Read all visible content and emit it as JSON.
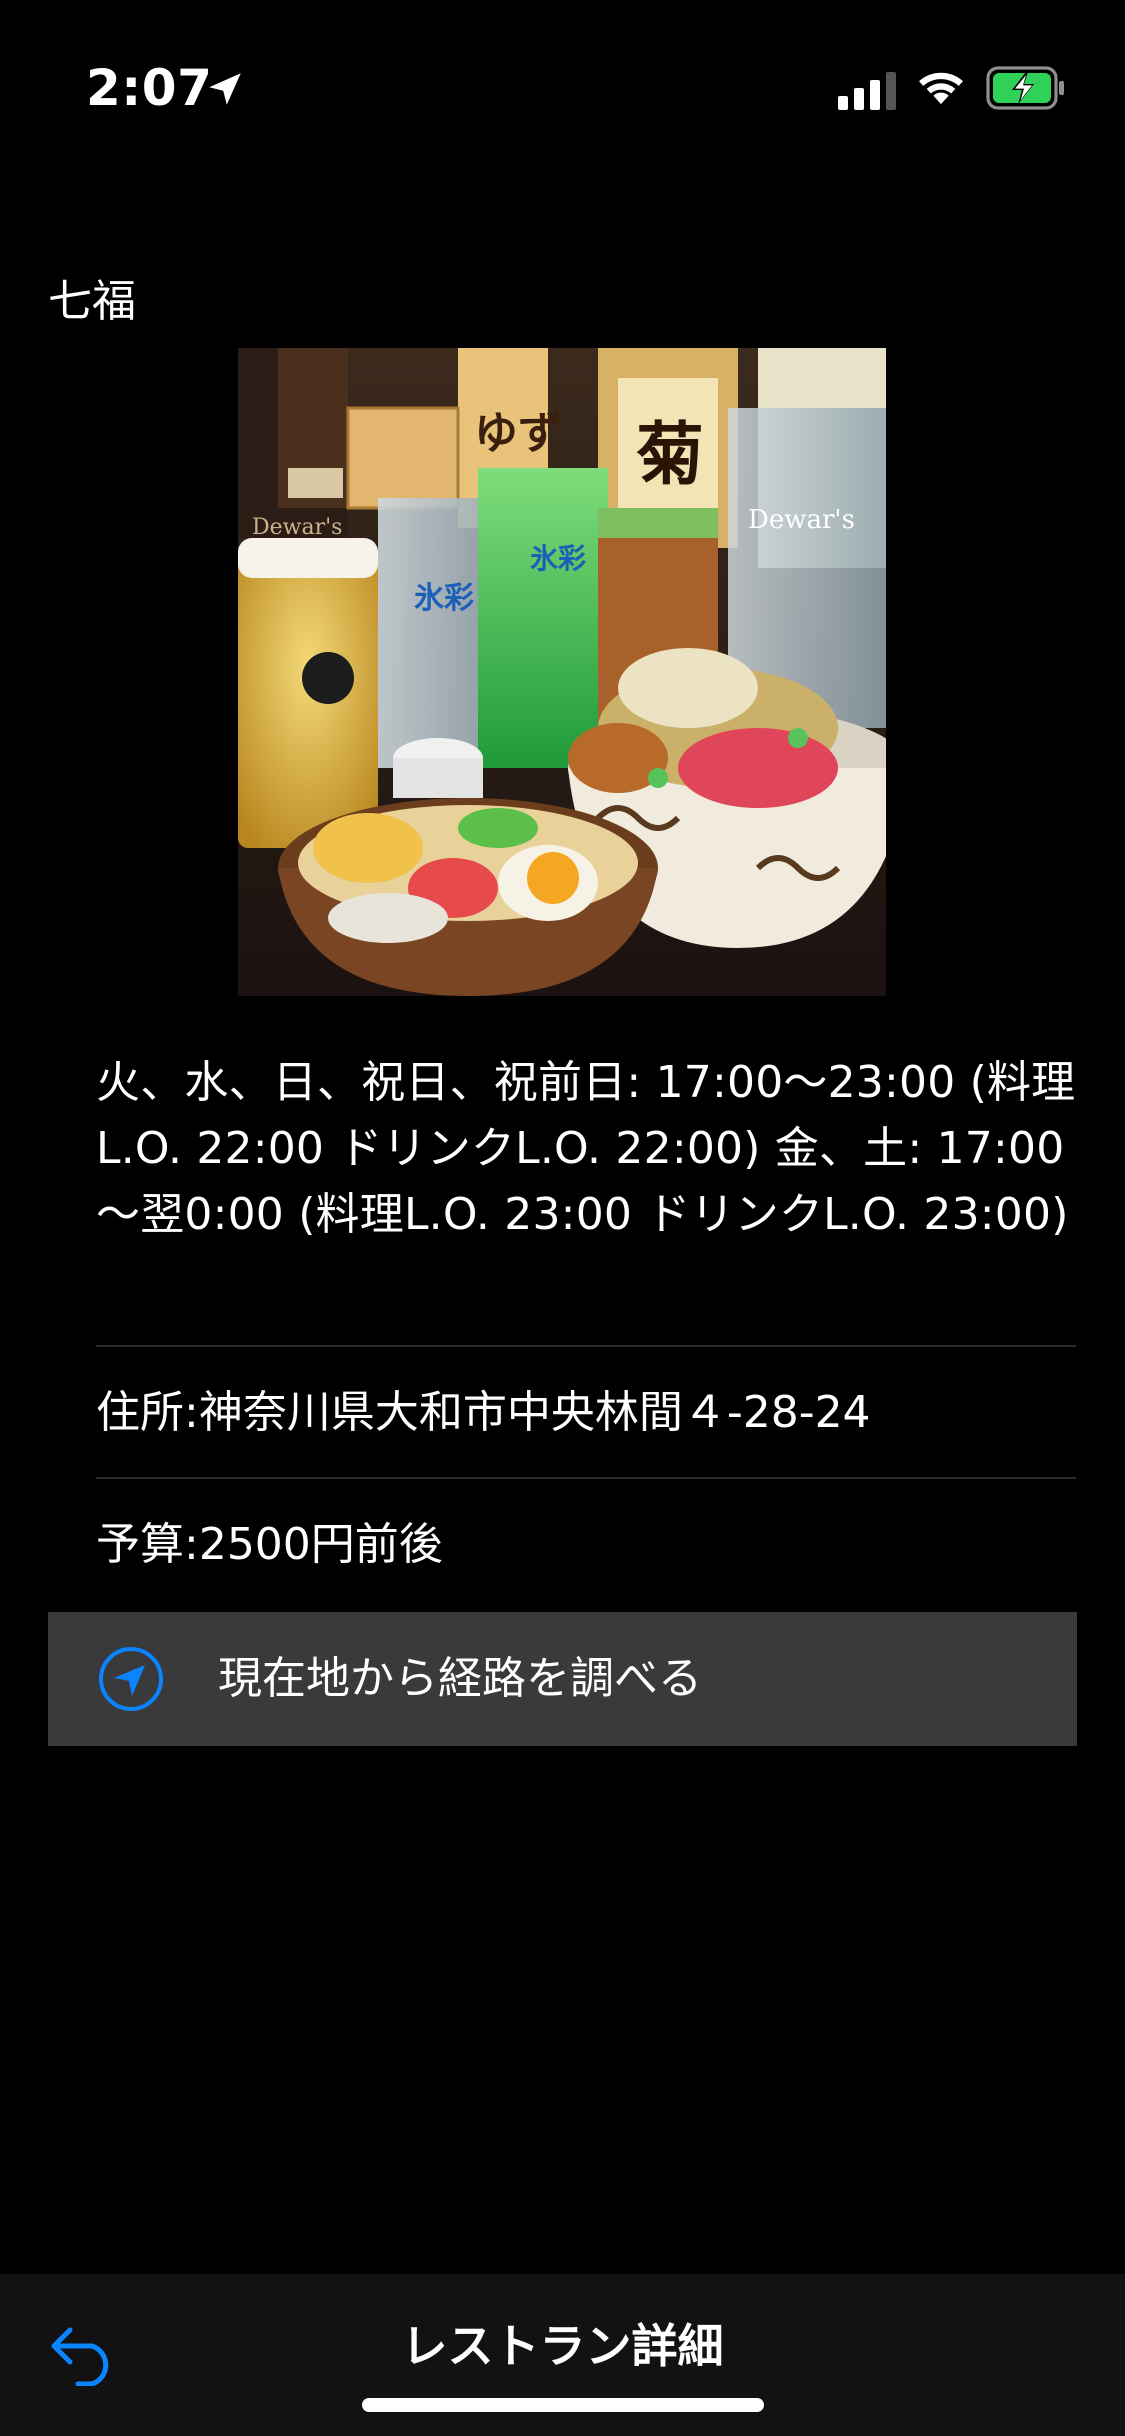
{
  "status_bar": {
    "time": "2:07",
    "icons": [
      "location-arrow-icon",
      "cellular-signal-icon",
      "wifi-icon",
      "battery-charging-icon"
    ],
    "battery_color": "#30d158"
  },
  "restaurant": {
    "name": "七福",
    "photo_signs": {
      "dewars_left": "Dewar's",
      "yuzu": "ゆず",
      "kiku": "菊",
      "hyosai_1": "氷彩",
      "hyosai_2": "氷彩",
      "dewars_right": "Dewar's"
    },
    "hours": "火、水、日、祝日、祝前日: 17:00～23:00 (料理L.O. 22:00 ドリンクL.O. 22:00) 金、土: 17:00～翌0:00 (料理L.O. 23:00 ドリンクL.O. 23:00)",
    "address": "住所:神奈川県大和市中央林間４-28-24",
    "budget": "予算:2500円前後"
  },
  "route_button": {
    "label": "現在地から経路を調べる",
    "icon": "navigation-arrow-icon",
    "accent": "#0a84ff"
  },
  "bottom_bar": {
    "title": "レストラン詳細",
    "back_icon": "return-arrow-icon"
  }
}
